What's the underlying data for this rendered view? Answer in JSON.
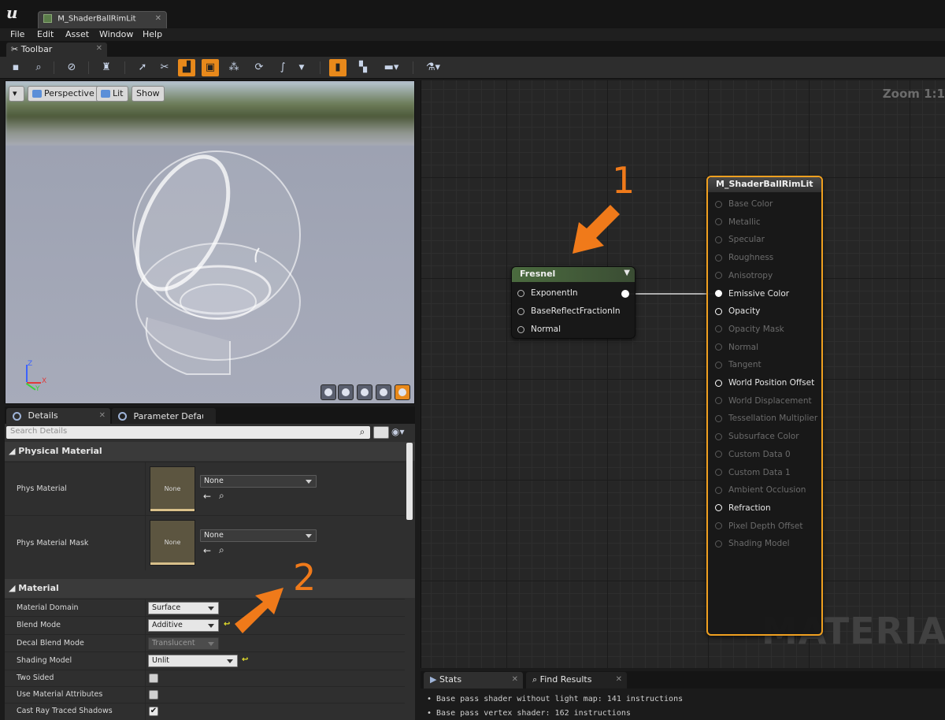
{
  "app": {
    "logo": "u",
    "doc_tab": "M_ShaderBallRimLit"
  },
  "menu": [
    "File",
    "Edit",
    "Asset",
    "Window",
    "Help"
  ],
  "toolbar_tab": "Toolbar",
  "viewport": {
    "view_mode": "Perspective",
    "lighting": "Lit",
    "show": "Show",
    "axis_x": "X",
    "axis_y": "Y",
    "axis_z": "Z"
  },
  "details": {
    "tabs": [
      "Details",
      "Parameter Defaults"
    ],
    "search_placeholder": "Search Details",
    "physical_material": {
      "title": "Physical Material",
      "rows": [
        {
          "label": "Phys Material",
          "thumb": "None",
          "value": "None"
        },
        {
          "label": "Phys Material Mask",
          "thumb": "None",
          "value": "None"
        }
      ]
    },
    "material": {
      "title": "Material",
      "rows": [
        {
          "label": "Material Domain",
          "value": "Surface"
        },
        {
          "label": "Blend Mode",
          "value": "Additive"
        },
        {
          "label": "Decal Blend Mode",
          "value": "Translucent"
        },
        {
          "label": "Shading Model",
          "value": "Unlit"
        },
        {
          "label": "Two Sided",
          "checked": false
        },
        {
          "label": "Use Material Attributes",
          "checked": false
        },
        {
          "label": "Cast Ray Traced Shadows",
          "checked": true
        }
      ]
    }
  },
  "graph": {
    "zoom": "Zoom 1:1",
    "watermark": "MATERIAL",
    "fresnel": {
      "title": "Fresnel",
      "inputs": [
        "ExponentIn",
        "BaseReflectFractionIn",
        "Normal"
      ]
    },
    "material_node": {
      "title": "M_ShaderBallRimLit",
      "pins": [
        {
          "label": "Base Color",
          "state": "dim"
        },
        {
          "label": "Metallic",
          "state": "dim"
        },
        {
          "label": "Specular",
          "state": "dim"
        },
        {
          "label": "Roughness",
          "state": "dim"
        },
        {
          "label": "Anisotropy",
          "state": "dim"
        },
        {
          "label": "Emissive Color",
          "state": "on"
        },
        {
          "label": "Opacity",
          "state": "hollow"
        },
        {
          "label": "Opacity Mask",
          "state": "dim"
        },
        {
          "label": "Normal",
          "state": "dim"
        },
        {
          "label": "Tangent",
          "state": "dim"
        },
        {
          "label": "World Position Offset",
          "state": "hollow"
        },
        {
          "label": "World Displacement",
          "state": "dim"
        },
        {
          "label": "Tessellation Multiplier",
          "state": "dim"
        },
        {
          "label": "Subsurface Color",
          "state": "dim"
        },
        {
          "label": "Custom Data 0",
          "state": "dim"
        },
        {
          "label": "Custom Data 1",
          "state": "dim"
        },
        {
          "label": "Ambient Occlusion",
          "state": "dim"
        },
        {
          "label": "Refraction",
          "state": "hollow"
        },
        {
          "label": "Pixel Depth Offset",
          "state": "dim"
        },
        {
          "label": "Shading Model",
          "state": "dim"
        }
      ]
    }
  },
  "callouts": [
    "1",
    "2"
  ],
  "bottom": {
    "tabs": [
      "Stats",
      "Find Results"
    ],
    "stats": [
      "•  Base pass shader without light map: 141 instructions",
      "•  Base pass vertex shader: 162 instructions"
    ]
  },
  "colors": {
    "accent": "#e8891b",
    "callout": "#f07a1a",
    "fresnel_header": "#4b6b3f"
  }
}
